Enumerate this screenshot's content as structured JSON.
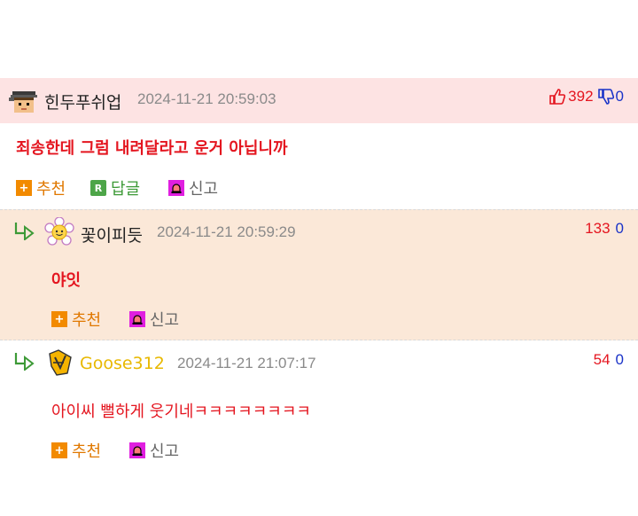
{
  "comments": [
    {
      "nickname": "힌두푸쉬업",
      "date": "2024-11-21 20:59:03",
      "upvotes": "392",
      "downvotes": "0",
      "text": "죄송한데 그럼 내려달라고 운거 아닙니까",
      "actions": {
        "recommend": "추천",
        "reply": "답글",
        "report": "신고"
      },
      "reply_icon_letter": "R"
    },
    {
      "nickname": "꽃이피듯",
      "date": "2024-11-21 20:59:29",
      "upvotes": "133",
      "downvotes": "0",
      "text": "야잇",
      "actions": {
        "recommend": "추천",
        "report": "신고"
      }
    },
    {
      "nickname": "Goose312",
      "date": "2024-11-21 21:07:17",
      "upvotes": "54",
      "downvotes": "0",
      "text": "아이씨 뻘하게 웃기네ㅋㅋㅋㅋㅋㅋㅋㅋ",
      "actions": {
        "recommend": "추천",
        "report": "신고"
      }
    }
  ],
  "colors": {
    "vote_up": "#e4151f",
    "vote_down": "#1a33c8",
    "comment_text": "#e4151f",
    "header_bg": "#fde3e3",
    "reply_bg": "#fbe8d8",
    "nick_gold": "#e8b800"
  },
  "icons": {
    "thumbs_up": "thumbs-up-icon",
    "thumbs_down": "thumbs-down-icon",
    "recommend": "plus-icon",
    "reply": "reply-r-icon",
    "report": "siren-icon",
    "reply_arrow": "reply-arrow-icon"
  }
}
